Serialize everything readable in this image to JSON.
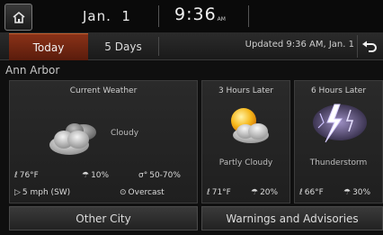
{
  "status_bar": {
    "date": "Jan.  1",
    "time": "9:36",
    "ampm": "AM"
  },
  "tabs": [
    {
      "label": "Today",
      "active": true
    },
    {
      "label": "5 Days",
      "active": false
    }
  ],
  "updated_text": "Updated 9:36 AM, Jan. 1",
  "city": "Ann Arbor",
  "current": {
    "title": "Current Weather",
    "condition": "Cloudy",
    "temperature": "76°F",
    "precipitation": "10%",
    "humidity": "50-70%",
    "wind": "5 mph (SW)",
    "sky": "Overcast"
  },
  "forecasts": [
    {
      "title": "3 Hours Later",
      "condition": "Partly Cloudy",
      "temperature": "71°F",
      "precipitation": "20%",
      "icon": "partly-cloudy-icon"
    },
    {
      "title": "6 Hours Later",
      "condition": "Thunderstorm",
      "temperature": "66°F",
      "precipitation": "30%",
      "icon": "thunderstorm-icon"
    }
  ],
  "buttons": {
    "other_city": "Other City",
    "warnings": "Warnings and Advisories"
  },
  "colors": {
    "active_tab": "#8a3218",
    "background": "#0f0f0f"
  }
}
